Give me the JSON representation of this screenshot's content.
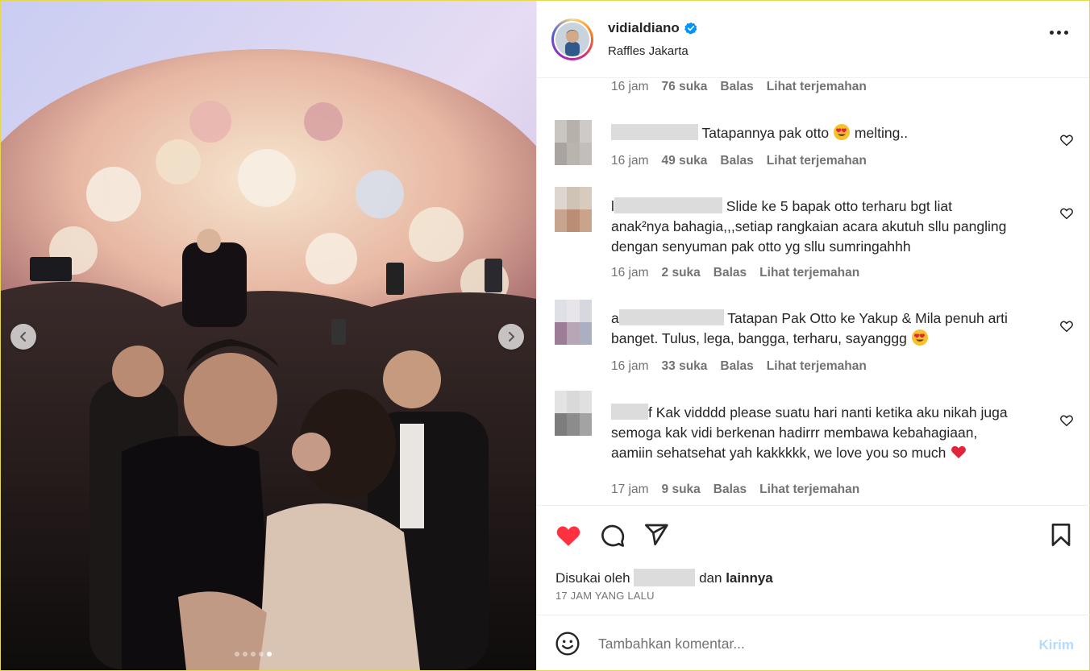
{
  "header": {
    "username": "vidialdiano",
    "location": "Raffles Jakarta"
  },
  "comments": [
    {
      "text": "",
      "time": "16 jam",
      "likes": "76 suka",
      "reply": "Balas",
      "translate": "Lihat terjemahan"
    },
    {
      "text": "Tatapannya pak otto",
      "text_after": "melting..",
      "time": "16 jam",
      "likes": "49 suka",
      "reply": "Balas",
      "translate": "Lihat terjemahan"
    },
    {
      "prefix": "l",
      "text": "Slide ke 5 bapak otto terharu bgt liat",
      "line2": "anak²nya bahagia,,,setiap rangkaian acara akutuh sllu pangling",
      "line3": "dengan senyuman pak otto yg sllu sumringahhh",
      "time": "16 jam",
      "likes": "2 suka",
      "reply": "Balas",
      "translate": "Lihat terjemahan"
    },
    {
      "prefix": "a",
      "text": "Tatapan Pak Otto ke Yakup & Mila penuh arti",
      "line2": "banget. Tulus, lega, bangga, terharu, sayanggg",
      "time": "16 jam",
      "likes": "33 suka",
      "reply": "Balas",
      "translate": "Lihat terjemahan"
    },
    {
      "prefix": "f",
      "text": "Kak vidddd please suatu hari nanti ketika aku nikah juga",
      "line2": "semoga kak vidi berkenan hadirrr membawa kebahagiaan,",
      "line3": "aamiin sehatsehat yah kakkkkk, we love you so much",
      "time": "17 jam",
      "likes": "9 suka",
      "reply": "Balas",
      "translate": "Lihat terjemahan"
    }
  ],
  "actions": {
    "liked_prefix": "Disukai oleh",
    "liked_and": "dan",
    "liked_others": "lainnya",
    "time_ago": "17 JAM YANG LALU"
  },
  "composer": {
    "placeholder": "Tambahkan komentar...",
    "post_label": "Kirim"
  },
  "carousel": {
    "slides": 5,
    "active_index": 4
  },
  "colors": {
    "like_red": "#ff3040",
    "verified_blue": "#0095f6",
    "post_button_disabled": "#b3dbff",
    "secondary_text": "#737373"
  },
  "icons": [
    "chevron-left-icon",
    "chevron-right-icon",
    "verified-badge-icon",
    "more-options-icon",
    "heart-icon",
    "heart-filled-icon",
    "comment-icon",
    "share-icon",
    "bookmark-icon",
    "emoji-icon",
    "heart-eyes-emoji",
    "red-heart-emoji"
  ]
}
